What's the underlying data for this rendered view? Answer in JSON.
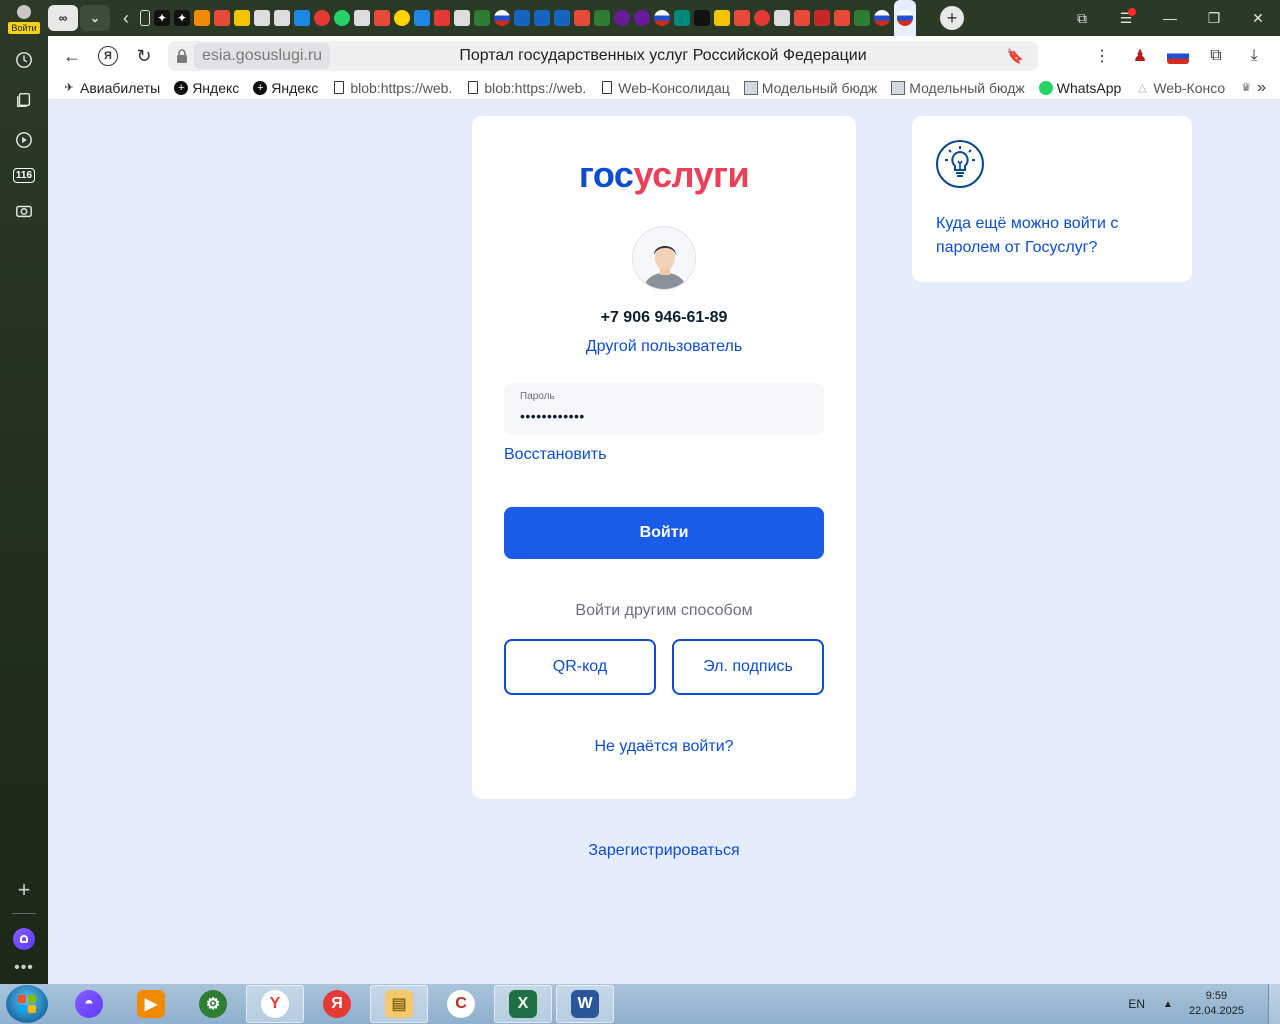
{
  "sidebar": {
    "profile_label": "Войти",
    "icons": [
      "history-icon",
      "collections-icon",
      "video-icon",
      "116-icon",
      "screenshot-icon"
    ],
    "badge_116": "116"
  },
  "browser": {
    "url": "esia.gosuslugi.ru",
    "page_title": "Портал государственных услуг Российской Федерации"
  },
  "bookmarks": [
    {
      "label": "Авиабилеты",
      "icon": "plane-icon"
    },
    {
      "label": "Яндекс",
      "icon": "yandex-plus-icon"
    },
    {
      "label": "Яндекс",
      "icon": "yandex-plus-icon"
    },
    {
      "label": "blob:https://web.",
      "icon": "doc-icon"
    },
    {
      "label": "blob:https://web.",
      "icon": "doc-icon"
    },
    {
      "label": "Web-Консолидац",
      "icon": "doc-icon"
    },
    {
      "label": "Модельный бюдж",
      "icon": "image-icon"
    },
    {
      "label": "Модельный бюдж",
      "icon": "image-icon"
    },
    {
      "label": "WhatsApp",
      "icon": "whatsapp-icon"
    },
    {
      "label": "Web-Консо",
      "icon": "triangle-icon"
    }
  ],
  "login": {
    "logo_part1": "гос",
    "logo_part2": "услуги",
    "phone": "+7 906 946-61-89",
    "other_user": "Другой пользователь",
    "password_label": "Пароль",
    "password_value": "••••••••••••",
    "restore": "Восстановить",
    "submit": "Войти",
    "other_way": "Войти другим способом",
    "qr": "QR-код",
    "signature": "Эл. подпись",
    "cant_login": "Не удаётся войти?",
    "register": "Зарегистрироваться"
  },
  "side_card": {
    "link": "Куда ещё можно войти с паролем от Госуслуг?"
  },
  "taskbar": {
    "lang": "EN",
    "time": "9:59",
    "date": "22.04.2025"
  },
  "colors": {
    "brand_blue": "#0d4cd3",
    "brand_red": "#ee3f58",
    "button_blue": "#1a5ce8",
    "page_bg": "#e5ecfb"
  }
}
